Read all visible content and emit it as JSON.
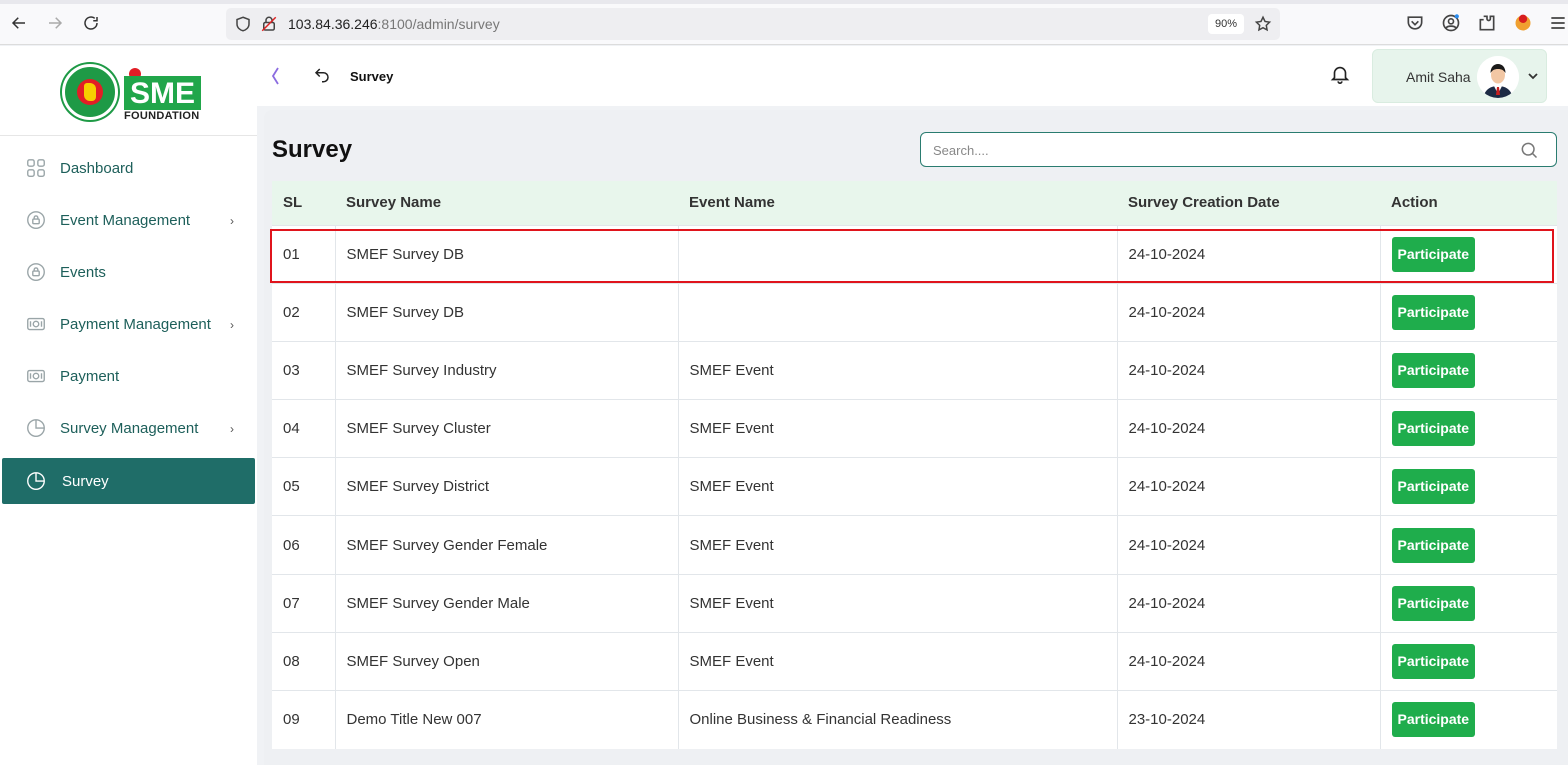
{
  "browser": {
    "url_host": "103.84.36.246",
    "url_rest": ":8100/admin/survey",
    "zoom": "90%"
  },
  "sidebar": {
    "logo": {
      "brand": "SME",
      "subtitle": "FOUNDATION"
    },
    "items": [
      {
        "label": "Dashboard",
        "icon": "grid-icon",
        "has_caret": false
      },
      {
        "label": "Event Management",
        "icon": "lock-circle-icon",
        "has_caret": true
      },
      {
        "label": "Events",
        "icon": "lock-circle-icon",
        "has_caret": false
      },
      {
        "label": "Payment Management",
        "icon": "money-icon",
        "has_caret": true
      },
      {
        "label": "Payment",
        "icon": "money-icon",
        "has_caret": false
      },
      {
        "label": "Survey Management",
        "icon": "pie-chart-icon",
        "has_caret": true
      },
      {
        "label": "Survey",
        "icon": "pie-chart-icon",
        "has_caret": false,
        "active": true
      }
    ]
  },
  "header": {
    "breadcrumb": "Survey",
    "user_name": "Amit Saha"
  },
  "main": {
    "title": "Survey",
    "search_placeholder": "Search....",
    "table": {
      "columns": [
        "SL",
        "Survey Name",
        "Event Name",
        "Survey Creation Date",
        "Action"
      ],
      "action_label": "Participate",
      "rows": [
        {
          "sl": "01",
          "name": "SMEF Survey DB",
          "event": "",
          "date": "24-10-2024"
        },
        {
          "sl": "02",
          "name": "SMEF Survey DB",
          "event": "",
          "date": "24-10-2024"
        },
        {
          "sl": "03",
          "name": "SMEF Survey Industry",
          "event": "SMEF Event",
          "date": "24-10-2024"
        },
        {
          "sl": "04",
          "name": "SMEF Survey Cluster",
          "event": "SMEF Event",
          "date": "24-10-2024"
        },
        {
          "sl": "05",
          "name": "SMEF Survey District",
          "event": "SMEF Event",
          "date": "24-10-2024"
        },
        {
          "sl": "06",
          "name": "SMEF Survey Gender Female",
          "event": "SMEF Event",
          "date": "24-10-2024"
        },
        {
          "sl": "07",
          "name": "SMEF Survey Gender Male",
          "event": "SMEF Event",
          "date": "24-10-2024"
        },
        {
          "sl": "08",
          "name": "SMEF Survey Open",
          "event": "SMEF Event",
          "date": "24-10-2024"
        },
        {
          "sl": "09",
          "name": "Demo Title New 007",
          "event": "Online Business & Financial Readiness",
          "date": "23-10-2024"
        }
      ]
    }
  },
  "colors": {
    "accent": "#1f6d68",
    "button": "#1fad4c",
    "header_row": "#e8f6ec",
    "highlight": "#e0141c"
  }
}
